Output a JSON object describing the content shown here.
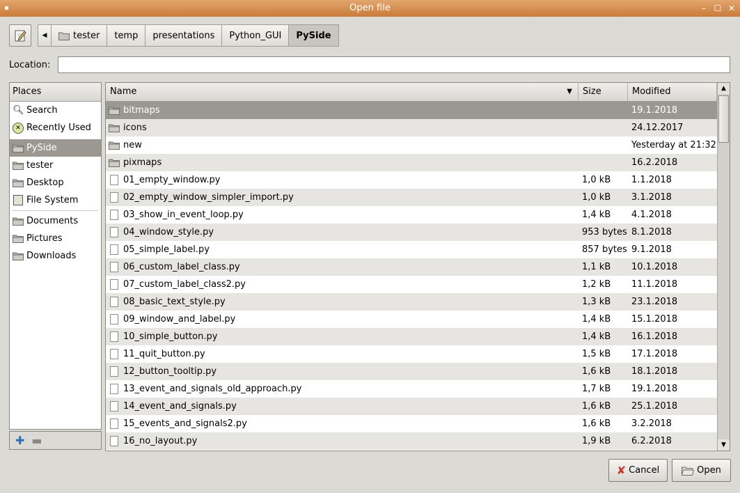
{
  "window": {
    "title": "Open file"
  },
  "pathbar": {
    "crumbs": [
      "tester",
      "temp",
      "presentations",
      "Python_GUI",
      "PySide"
    ]
  },
  "location": {
    "label": "Location:",
    "value": ""
  },
  "places": {
    "header": "Places",
    "items": [
      {
        "label": "Search",
        "icon": "search-icon"
      },
      {
        "label": "Recently Used",
        "icon": "clock-icon"
      },
      {
        "label": "PySide",
        "icon": "folder-icon",
        "selected": true
      },
      {
        "label": "tester",
        "icon": "folder-icon"
      },
      {
        "label": "Desktop",
        "icon": "folder-icon"
      },
      {
        "label": "File System",
        "icon": "drive-icon"
      },
      {
        "label": "Documents",
        "icon": "folder-icon"
      },
      {
        "label": "Pictures",
        "icon": "folder-icon"
      },
      {
        "label": "Downloads",
        "icon": "folder-icon"
      }
    ]
  },
  "files": {
    "columns": {
      "name": "Name",
      "size": "Size",
      "modified": "Modified"
    },
    "rows": [
      {
        "name": "bitmaps",
        "size": "",
        "modified": "19.1.2018",
        "type": "folder"
      },
      {
        "name": "icons",
        "size": "",
        "modified": "24.12.2017",
        "type": "folder"
      },
      {
        "name": "new",
        "size": "",
        "modified": "Yesterday at 21:32",
        "type": "folder"
      },
      {
        "name": "pixmaps",
        "size": "",
        "modified": "16.2.2018",
        "type": "folder"
      },
      {
        "name": "01_empty_window.py",
        "size": "1,0 kB",
        "modified": "1.1.2018",
        "type": "file"
      },
      {
        "name": "02_empty_window_simpler_import.py",
        "size": "1,0 kB",
        "modified": "3.1.2018",
        "type": "file"
      },
      {
        "name": "03_show_in_event_loop.py",
        "size": "1,4 kB",
        "modified": "4.1.2018",
        "type": "file"
      },
      {
        "name": "04_window_style.py",
        "size": "953 bytes",
        "modified": "8.1.2018",
        "type": "file"
      },
      {
        "name": "05_simple_label.py",
        "size": "857 bytes",
        "modified": "9.1.2018",
        "type": "file"
      },
      {
        "name": "06_custom_label_class.py",
        "size": "1,1 kB",
        "modified": "10.1.2018",
        "type": "file"
      },
      {
        "name": "07_custom_label_class2.py",
        "size": "1,2 kB",
        "modified": "11.1.2018",
        "type": "file"
      },
      {
        "name": "08_basic_text_style.py",
        "size": "1,3 kB",
        "modified": "23.1.2018",
        "type": "file"
      },
      {
        "name": "09_window_and_label.py",
        "size": "1,4 kB",
        "modified": "15.1.2018",
        "type": "file"
      },
      {
        "name": "10_simple_button.py",
        "size": "1,4 kB",
        "modified": "16.1.2018",
        "type": "file"
      },
      {
        "name": "11_quit_button.py",
        "size": "1,5 kB",
        "modified": "17.1.2018",
        "type": "file"
      },
      {
        "name": "12_button_tooltip.py",
        "size": "1,6 kB",
        "modified": "18.1.2018",
        "type": "file"
      },
      {
        "name": "13_event_and_signals_old_approach.py",
        "size": "1,7 kB",
        "modified": "19.1.2018",
        "type": "file"
      },
      {
        "name": "14_event_and_signals.py",
        "size": "1,6 kB",
        "modified": "25.1.2018",
        "type": "file"
      },
      {
        "name": "15_events_and_signals2.py",
        "size": "1,6 kB",
        "modified": "3.2.2018",
        "type": "file"
      },
      {
        "name": "16_no_layout.py",
        "size": "1,9 kB",
        "modified": "6.2.2018",
        "type": "file"
      }
    ]
  },
  "buttons": {
    "cancel": "Cancel",
    "open": "Open"
  },
  "colors": {
    "titlebar": "#d18a4c",
    "selection": "#9b9892"
  }
}
